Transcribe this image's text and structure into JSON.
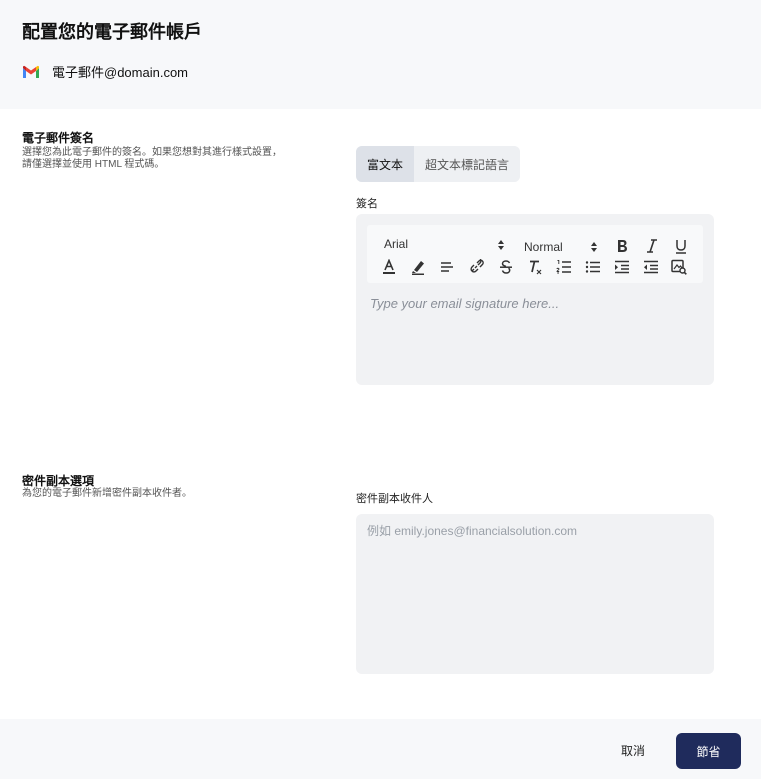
{
  "header": {
    "title": "配置您的電子郵件帳戶",
    "account_email": "電子郵件@domain.com"
  },
  "signature_section": {
    "title": "電子郵件簽名",
    "description_line1": "選擇您為此電子郵件的簽名。如果您想對其進行樣式設置，",
    "description_line2": "請僅選擇並使用 HTML 程式碼。",
    "tabs": [
      {
        "label": "富文本",
        "active": true
      },
      {
        "label": "超文本標記語言",
        "active": false
      }
    ],
    "field_label": "簽名",
    "toolbar": {
      "font_value": "Arial",
      "size_value": "Normal"
    },
    "placeholder": "Type your email signature here..."
  },
  "bcc_section": {
    "title": "密件副本選項",
    "description": "為您的電子郵件新增密件副本收件者。",
    "field_label": "密件副本收件人",
    "placeholder": "例如 emily.jones@financialsolution.com"
  },
  "footer": {
    "cancel_label": "取消",
    "save_label": "節省"
  },
  "colors": {
    "primary_button": "#1f2b5c",
    "panel_background": "#f1f2f4",
    "header_background": "#f7f8fa"
  }
}
